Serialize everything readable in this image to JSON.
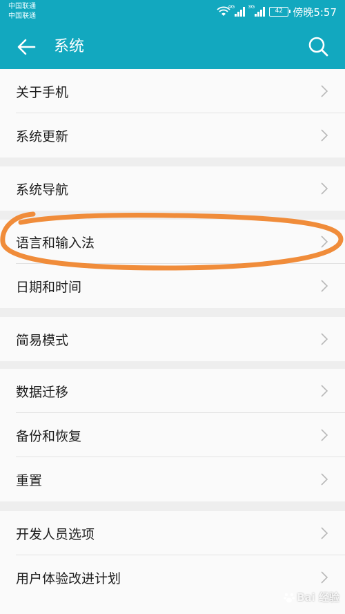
{
  "status_bar": {
    "carrier_1": "中国联通",
    "carrier_2": "中国联通",
    "signal_1_label": "4G",
    "signal_2_label": "3G",
    "battery": "42",
    "time": "傍晚5:57"
  },
  "header": {
    "title": "系统",
    "back_icon": "arrow-left-icon",
    "search_icon": "search-icon",
    "bg_color": "#12a8bf"
  },
  "groups": [
    {
      "items": [
        {
          "label": "关于手机"
        },
        {
          "label": "系统更新"
        }
      ]
    },
    {
      "items": [
        {
          "label": "系统导航"
        }
      ]
    },
    {
      "items": [
        {
          "label": "语言和输入法"
        },
        {
          "label": "日期和时间"
        }
      ]
    },
    {
      "items": [
        {
          "label": "简易模式"
        }
      ]
    },
    {
      "items": [
        {
          "label": "数据迁移"
        },
        {
          "label": "备份和恢复"
        },
        {
          "label": "重置"
        }
      ]
    },
    {
      "items": [
        {
          "label": "开发人员选项"
        },
        {
          "label": "用户体验改进计划"
        }
      ]
    }
  ],
  "annotation_color": "#f08c3a",
  "watermark": {
    "text": "Bai 经验"
  }
}
